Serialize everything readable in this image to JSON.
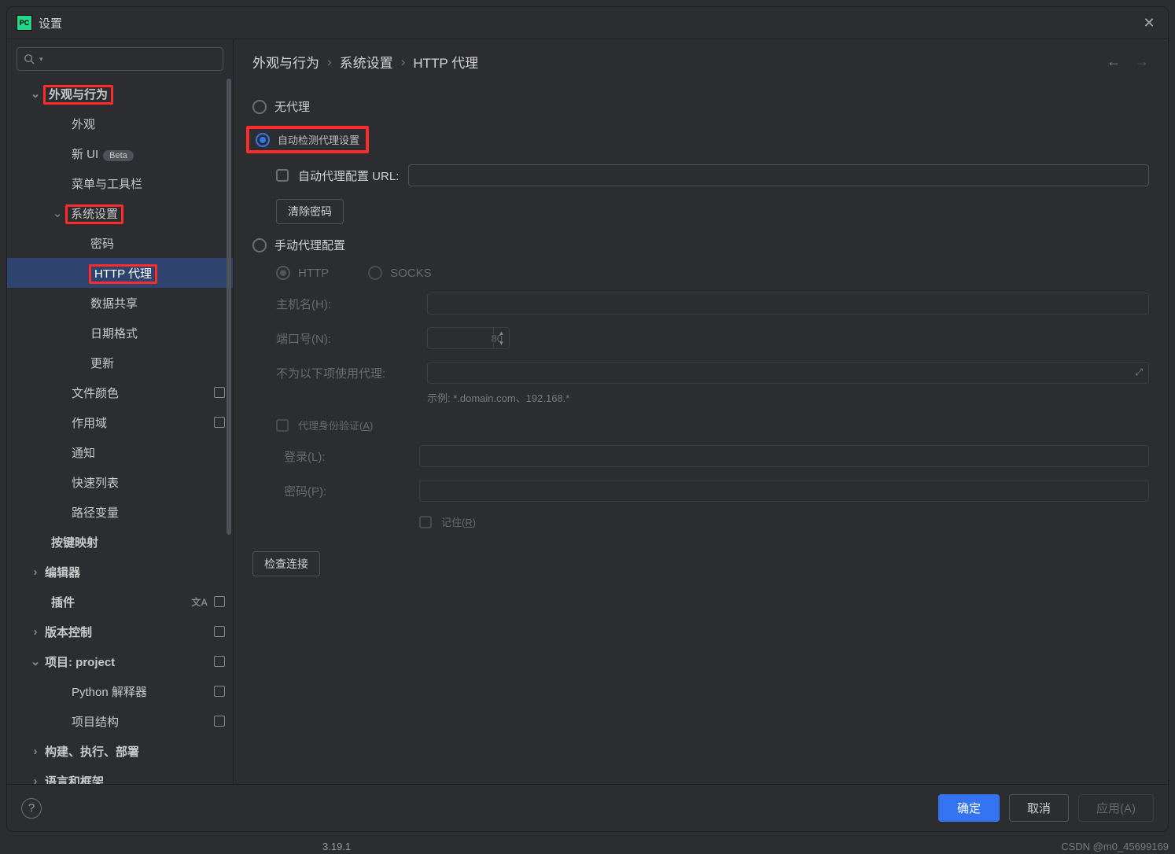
{
  "window": {
    "title": "设置"
  },
  "breadcrumb": {
    "a": "外观与行为",
    "b": "系统设置",
    "c": "HTTP 代理"
  },
  "sidebar": {
    "appearance_behavior": "外观与行为",
    "appearance": "外观",
    "new_ui": "新 UI",
    "new_ui_badge": "Beta",
    "menus_toolbars": "菜单与工具栏",
    "system_settings": "系统设置",
    "passwords": "密码",
    "http_proxy": "HTTP 代理",
    "data_sharing": "数据共享",
    "date_format": "日期格式",
    "updates": "更新",
    "file_colors": "文件颜色",
    "scopes": "作用域",
    "notifications": "通知",
    "quick_lists": "快速列表",
    "path_variables": "路径变量",
    "keymap": "按键映射",
    "editor": "编辑器",
    "plugins": "插件",
    "version_control": "版本控制",
    "project": "项目: project",
    "python_interpreter": "Python 解释器",
    "project_structure": "项目结构",
    "build_exec_deploy": "构建、执行、部署",
    "lang_framework": "语言和框架"
  },
  "proxy": {
    "no_proxy": "无代理",
    "auto_detect": "自动检测代理设置",
    "auto_config_url": "自动代理配置 URL:",
    "clear_passwords": "清除密码",
    "manual": "手动代理配置",
    "http": "HTTP",
    "socks": "SOCKS",
    "host": "主机名(H):",
    "port": "端口号(N):",
    "port_value": "80",
    "no_proxy_for": "不为以下项使用代理:",
    "example": "示例: *.domain.com、192.168.*",
    "auth": "代理身份验证(A)",
    "login": "登录(L):",
    "password": "密码(P):",
    "remember": "记住(R)",
    "check_connection": "检查连接"
  },
  "footer": {
    "ok": "确定",
    "cancel": "取消",
    "apply": "应用(A)"
  },
  "watermark": "CSDN @m0_45699169",
  "version": "3.19.1"
}
